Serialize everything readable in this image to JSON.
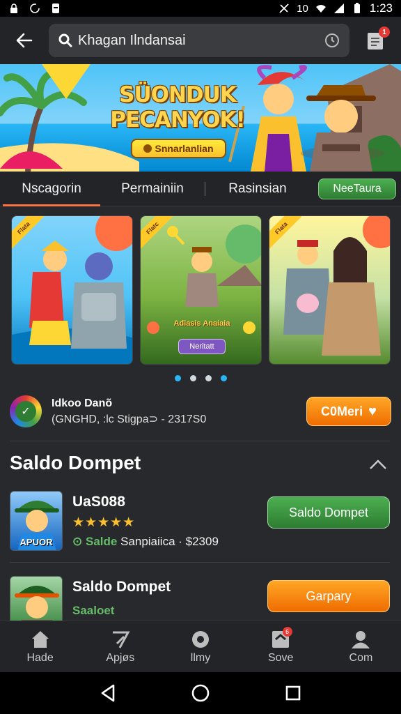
{
  "status_bar": {
    "time": "1:23",
    "signal_text": "10"
  },
  "app_bar": {
    "search_text": "Khagan Ilndansai",
    "notification_count": "1"
  },
  "banner": {
    "title": "SÜONDUK PECANYOK!",
    "cta_label": "Snnarlanlian"
  },
  "tabs": [
    {
      "label": "Nscagorin",
      "active": true
    },
    {
      "label": "Permainiin",
      "active": false
    },
    {
      "label": "Rasinsian",
      "active": false
    }
  ],
  "new_feature_button": "NeeTaura",
  "carousel": {
    "cards": [
      {
        "ribbon": "Flata"
      },
      {
        "ribbon": "Flatc",
        "title": "Adiasis Anaiaia",
        "button": "Neritatt"
      },
      {
        "ribbon": "Flata"
      }
    ],
    "dot_count": 4,
    "active_dots": [
      0,
      3
    ]
  },
  "game": {
    "name": "Idkoo Danõ",
    "subtitle": "(GNGHD, :lc Stigpa⊃ - 2317S0",
    "connect_label": "C0Meri"
  },
  "section": {
    "title": "Saldo Dompet"
  },
  "wallet_items": [
    {
      "thumb_label": "APUOR",
      "title": "UaS088",
      "stars": "★★★★★",
      "meta_green": "Salde",
      "meta_rest": "Sanpiaiica · $2309",
      "button": "Saldo Dompet"
    },
    {
      "thumb_label": "",
      "title": "Saldo Dompet",
      "meta_green": "Saaloet",
      "meta_rest": "",
      "button": "Garpary"
    }
  ],
  "bottom_nav": [
    {
      "label": "Hadе",
      "icon": "home-icon"
    },
    {
      "label": "Apjøs",
      "icon": "apps-icon"
    },
    {
      "label": "llmy",
      "icon": "game-icon"
    },
    {
      "label": "Sove",
      "icon": "save-icon",
      "badge": "6"
    },
    {
      "label": "Com",
      "icon": "profile-icon"
    }
  ],
  "colors": {
    "accent_orange": "#ff7043",
    "accent_green": "#4caf50",
    "button_orange": "#ef6c00",
    "active_dot": "#29b6f6"
  }
}
